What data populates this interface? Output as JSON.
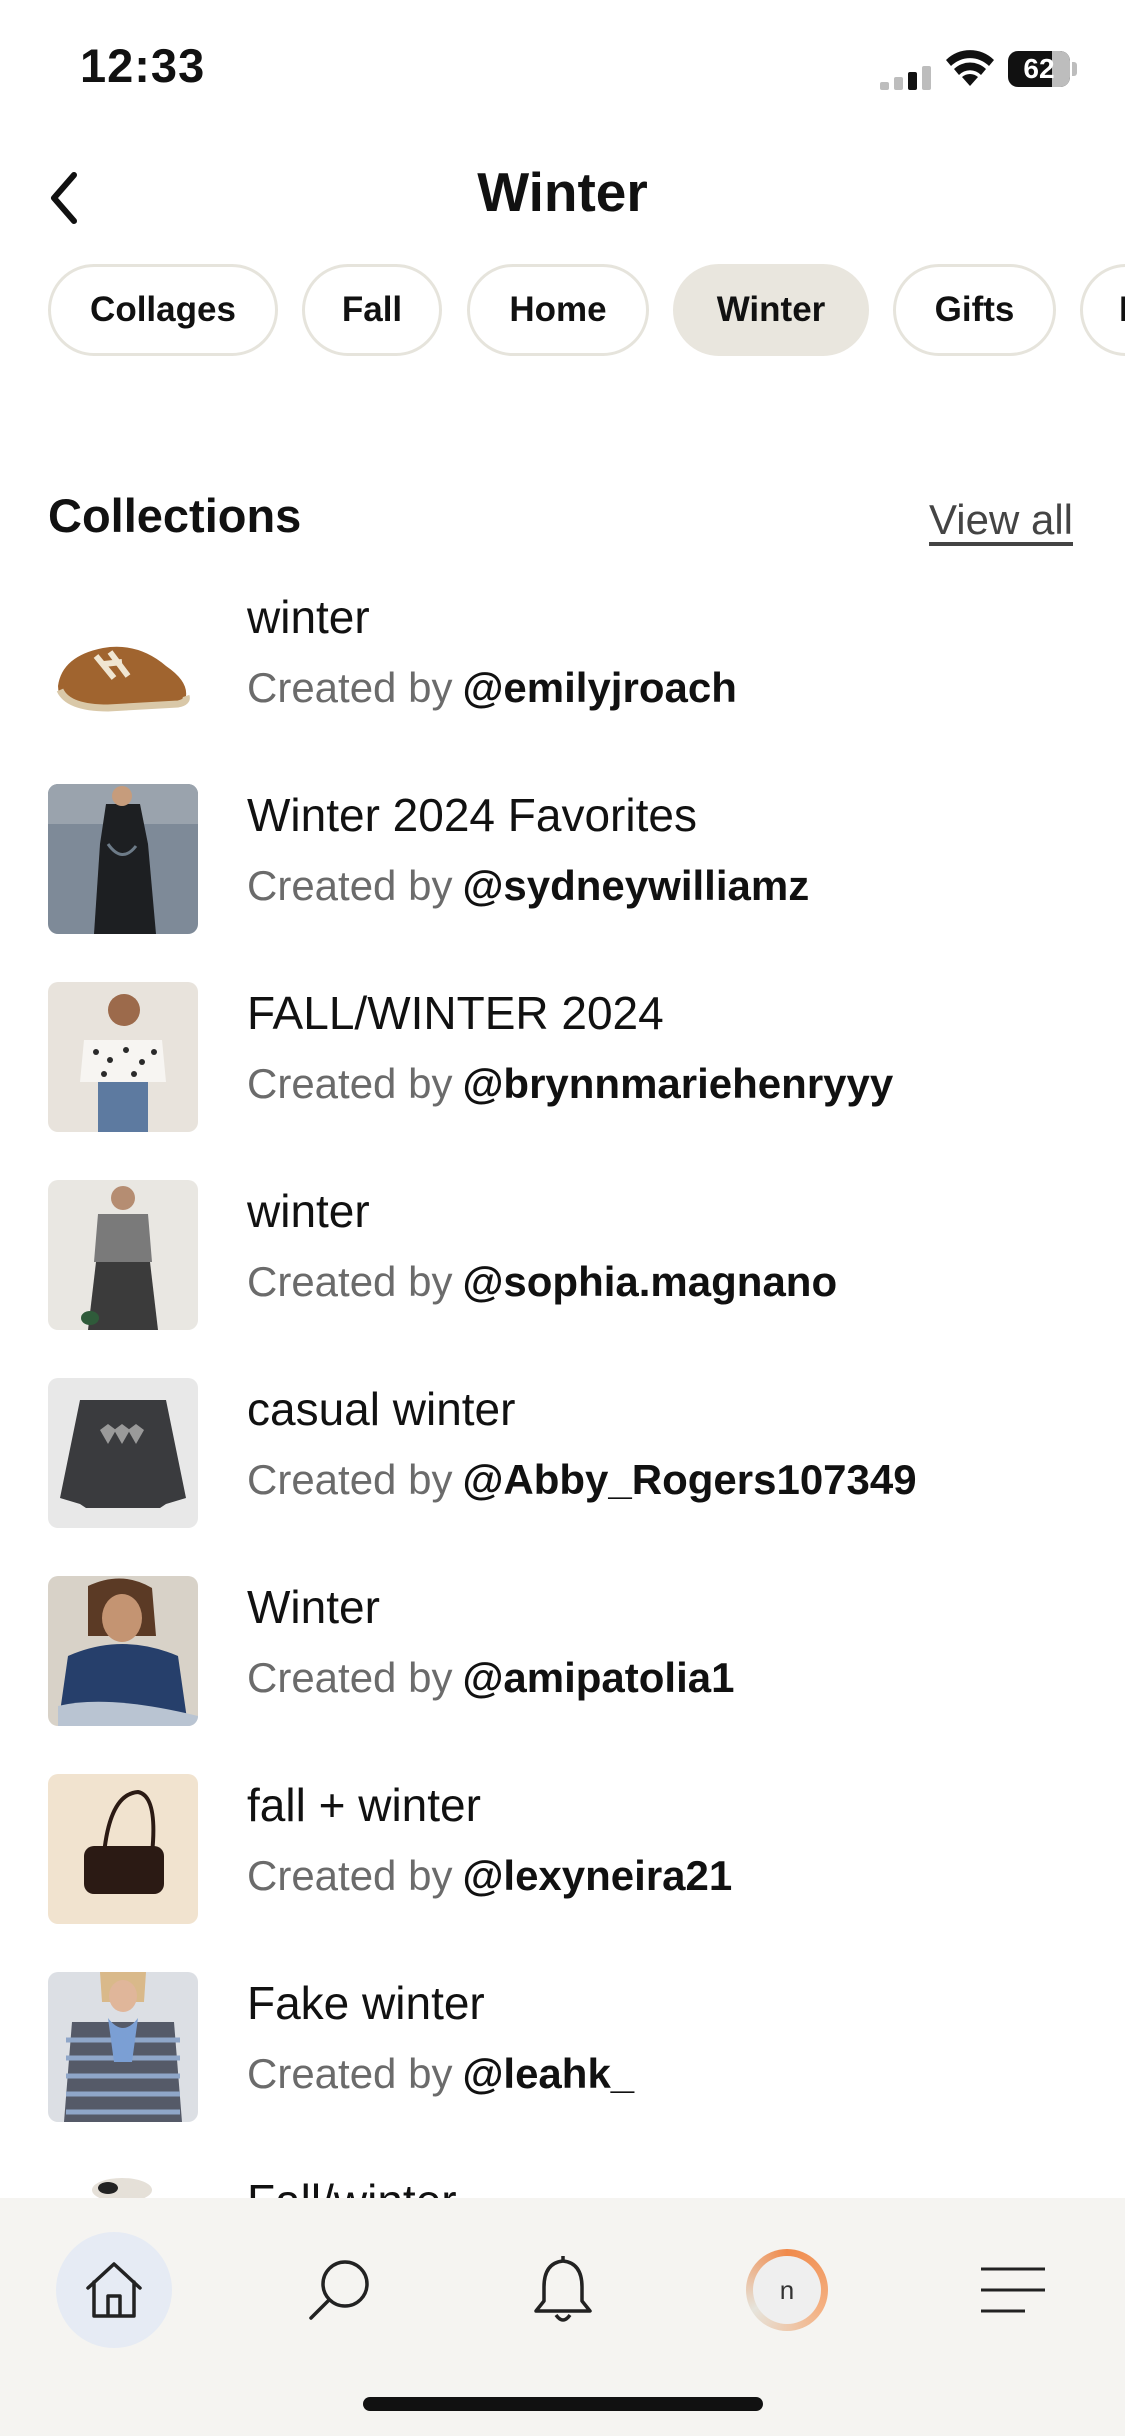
{
  "status_bar": {
    "time": "12:33",
    "battery": "62"
  },
  "header": {
    "title": "Winter"
  },
  "chips": [
    {
      "label": "Collages",
      "active": false
    },
    {
      "label": "Fall",
      "active": false
    },
    {
      "label": "Home",
      "active": false
    },
    {
      "label": "Winter",
      "active": true
    },
    {
      "label": "Gifts",
      "active": false
    },
    {
      "label": "Holiday",
      "active": false
    }
  ],
  "collections": {
    "title": "Collections",
    "view_all": "View all",
    "created_by_label": "Created by",
    "items": [
      {
        "title": "winter",
        "user": "@emilyjroach"
      },
      {
        "title": "Winter 2024 Favorites",
        "user": "@sydneywilliamz"
      },
      {
        "title": "FALL/WINTER 2024",
        "user": "@brynnmariehenryyy"
      },
      {
        "title": "winter",
        "user": "@sophia.magnano"
      },
      {
        "title": "casual winter",
        "user": "@Abby_Rogers107349"
      },
      {
        "title": "Winter",
        "user": "@amipatolia1"
      },
      {
        "title": "fall + winter",
        "user": "@lexyneira21"
      },
      {
        "title": "Fake winter",
        "user": "@leahk_"
      },
      {
        "title": "Fall/winter",
        "user": ""
      }
    ]
  },
  "bottom_nav": {
    "items": [
      "home-icon",
      "search-icon",
      "bell-icon",
      "profile-avatar",
      "menu-icon"
    ],
    "avatar_initial": "n"
  }
}
